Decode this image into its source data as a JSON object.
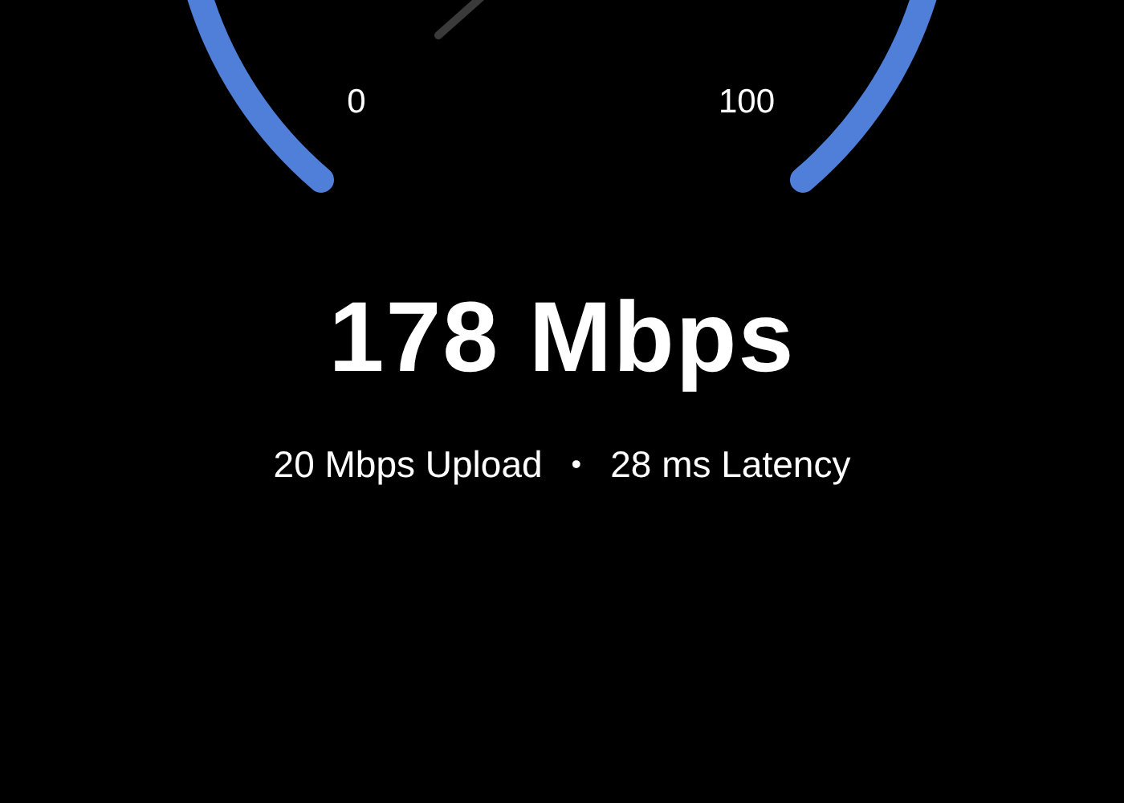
{
  "gauge": {
    "min_label": "0",
    "max_label": "100"
  },
  "speed": "178 Mbps",
  "details": [
    {
      "kind": "text",
      "text": "20 Mbps Upload"
    },
    {
      "kind": "separator",
      "text": "•"
    },
    {
      "kind": "text",
      "text": "28 ms Latency"
    }
  ]
}
